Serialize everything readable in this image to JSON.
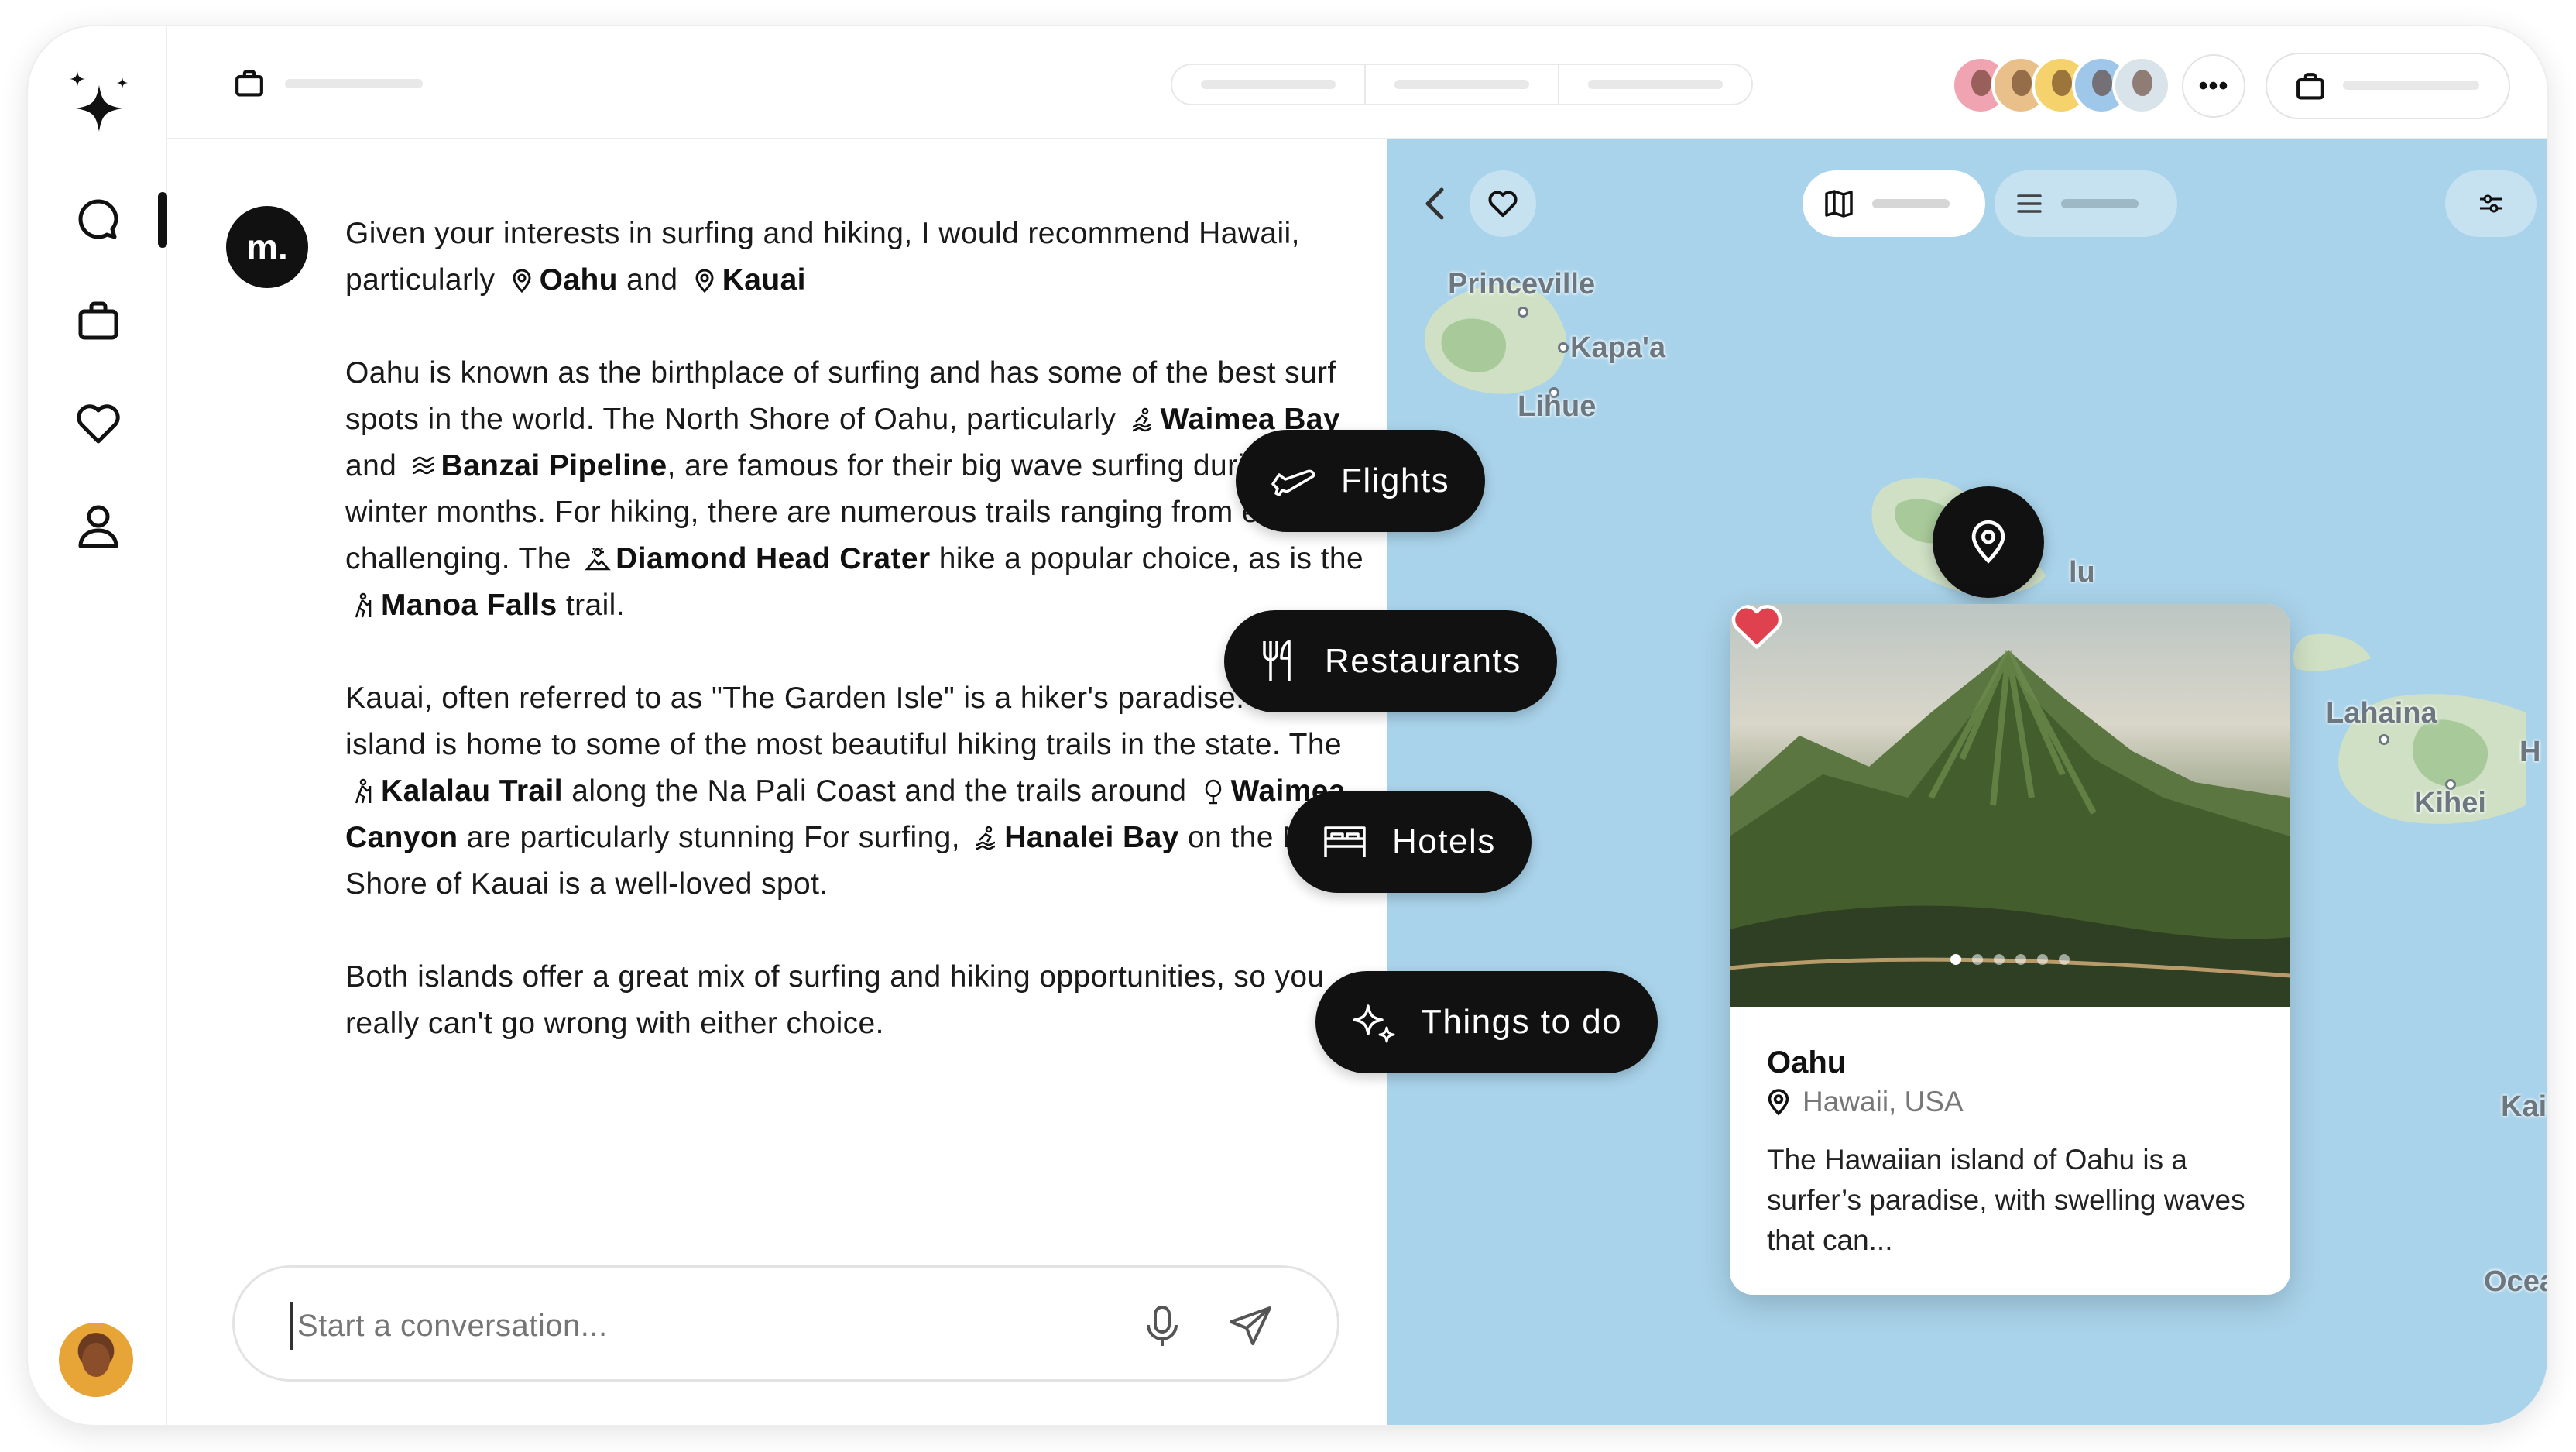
{
  "bot": {
    "avatar_text": "m."
  },
  "message": {
    "p1": {
      "t1": "Given your interests in surfing and hiking, I would recommend Hawaii, particularly",
      "place1": "Oahu",
      "and": "and",
      "place2": "Kauai"
    },
    "p2": {
      "t1": "Oahu is known as the birthplace of surfing and has some of the best surf spots in the world. The North Shore of Oahu, particularly",
      "spot1": "Waimea Bay",
      "and": "and",
      "spot2": "Banzai Pipeline",
      "t2": ", are famous for their big wave surfing during the winter months. For hiking, there are numerous trails ranging from easy to challenging. The",
      "trail1": "Diamond Head Crater",
      "t3": "hike a popular choice, as is the",
      "trail2": "Manoa Falls",
      "t4": "trail."
    },
    "p3": {
      "t1": "Kauai, often referred to as \"The Garden Isle\" is a hiker's paradise. The island is home to some of the most beautiful hiking trails in the state. The",
      "trail1": "Kalalau Trail",
      "t2": "along the Na Pali Coast and the trails around",
      "trail2": "Waimea Canyon",
      "t3": "are particularly stunning For surfing,",
      "spot": "Hanalei Bay",
      "t4": "on the North Shore of Kauai is a well-loved spot."
    },
    "p4": "Both islands offer a great mix of surfing and hiking opportunities, so you really can't go wrong with either choice."
  },
  "composer": {
    "placeholder": "Start a conversation..."
  },
  "pills": [
    {
      "label": "Flights",
      "icon": "plane-icon"
    },
    {
      "label": "Restaurants",
      "icon": "fork-knife-icon"
    },
    {
      "label": "Hotels",
      "icon": "bed-icon"
    },
    {
      "label": "Things to do",
      "icon": "sparkles-icon"
    }
  ],
  "map": {
    "labels": {
      "princeville": "Princeville",
      "kapaa": "Kapa'a",
      "lihue": "Lihue",
      "honolulu_fragment": "lu",
      "lahaina": "Lahaina",
      "kihei": "Kihei",
      "h_fragment": "H",
      "kailua_fragment": "Kailu",
      "ocean_fragment": "Ocean"
    },
    "colors": {
      "ocean": "#a9d3ea",
      "land": "#cfe0c4",
      "land_dark": "#a8c99a"
    }
  },
  "card": {
    "title": "Oahu",
    "location": "Hawaii, USA",
    "description": "The Hawaiian island of Oahu is a surfer’s paradise, with swelling waves that can...",
    "image_count": 6,
    "active_image": 1,
    "favorited": true
  },
  "topbar": {
    "more_label": "•••"
  }
}
